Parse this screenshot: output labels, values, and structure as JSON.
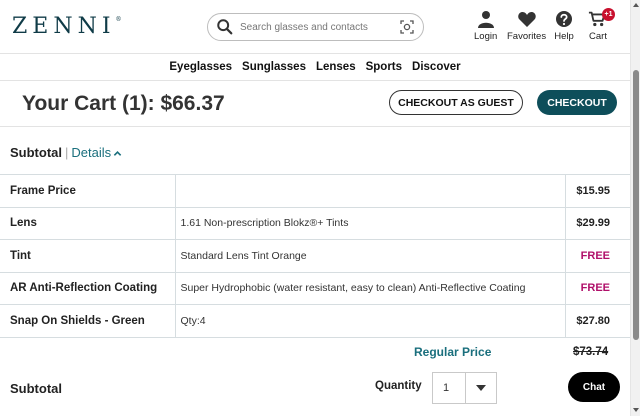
{
  "header": {
    "logo": "ZENNI",
    "logo_mark": "®",
    "search_placeholder": "Search glasses and contacts",
    "nav": [
      {
        "label": "Login",
        "icon": "user-icon"
      },
      {
        "label": "Favorites",
        "icon": "heart-icon"
      },
      {
        "label": "Help",
        "icon": "help-icon"
      },
      {
        "label": "Cart",
        "icon": "cart-icon",
        "badge": "+1"
      }
    ]
  },
  "category_nav": [
    "Eyeglasses",
    "Sunglasses",
    "Lenses",
    "Sports",
    "Discover"
  ],
  "cart": {
    "title": "Your Cart (1): $66.37",
    "guest_button": "CHECKOUT AS GUEST",
    "checkout_button": "CHECKOUT"
  },
  "subtotal": {
    "label": "Subtotal",
    "separator": "|",
    "details_link": "Details"
  },
  "items": [
    {
      "name": "Frame Price",
      "desc": "",
      "price": "$15.95"
    },
    {
      "name": "Lens",
      "desc": "1.61 Non-prescription Blokz®+ Tints",
      "price": "$29.99"
    },
    {
      "name": "Tint",
      "desc": "Standard Lens Tint Orange",
      "price": "FREE"
    },
    {
      "name": "AR Anti-Reflection Coating",
      "desc": "Super Hydrophobic (water resistant, easy to clean) Anti-Reflective Coating",
      "price": "FREE"
    },
    {
      "name": "Snap On Shields - Green",
      "desc": "Qty:4",
      "price": "$27.80"
    }
  ],
  "pricing": {
    "regular_label": "Regular Price",
    "regular_price": "$73.74"
  },
  "bottom": {
    "subtotal_label": "Subtotal",
    "quantity_label": "Quantity",
    "quantity_value": "1"
  },
  "chat_label": "Chat",
  "colors": {
    "brand": "#0f3b47",
    "accent": "#0e4e5a",
    "link": "#1a6f7d",
    "free": "#b0106a",
    "badge": "#c8102e"
  }
}
